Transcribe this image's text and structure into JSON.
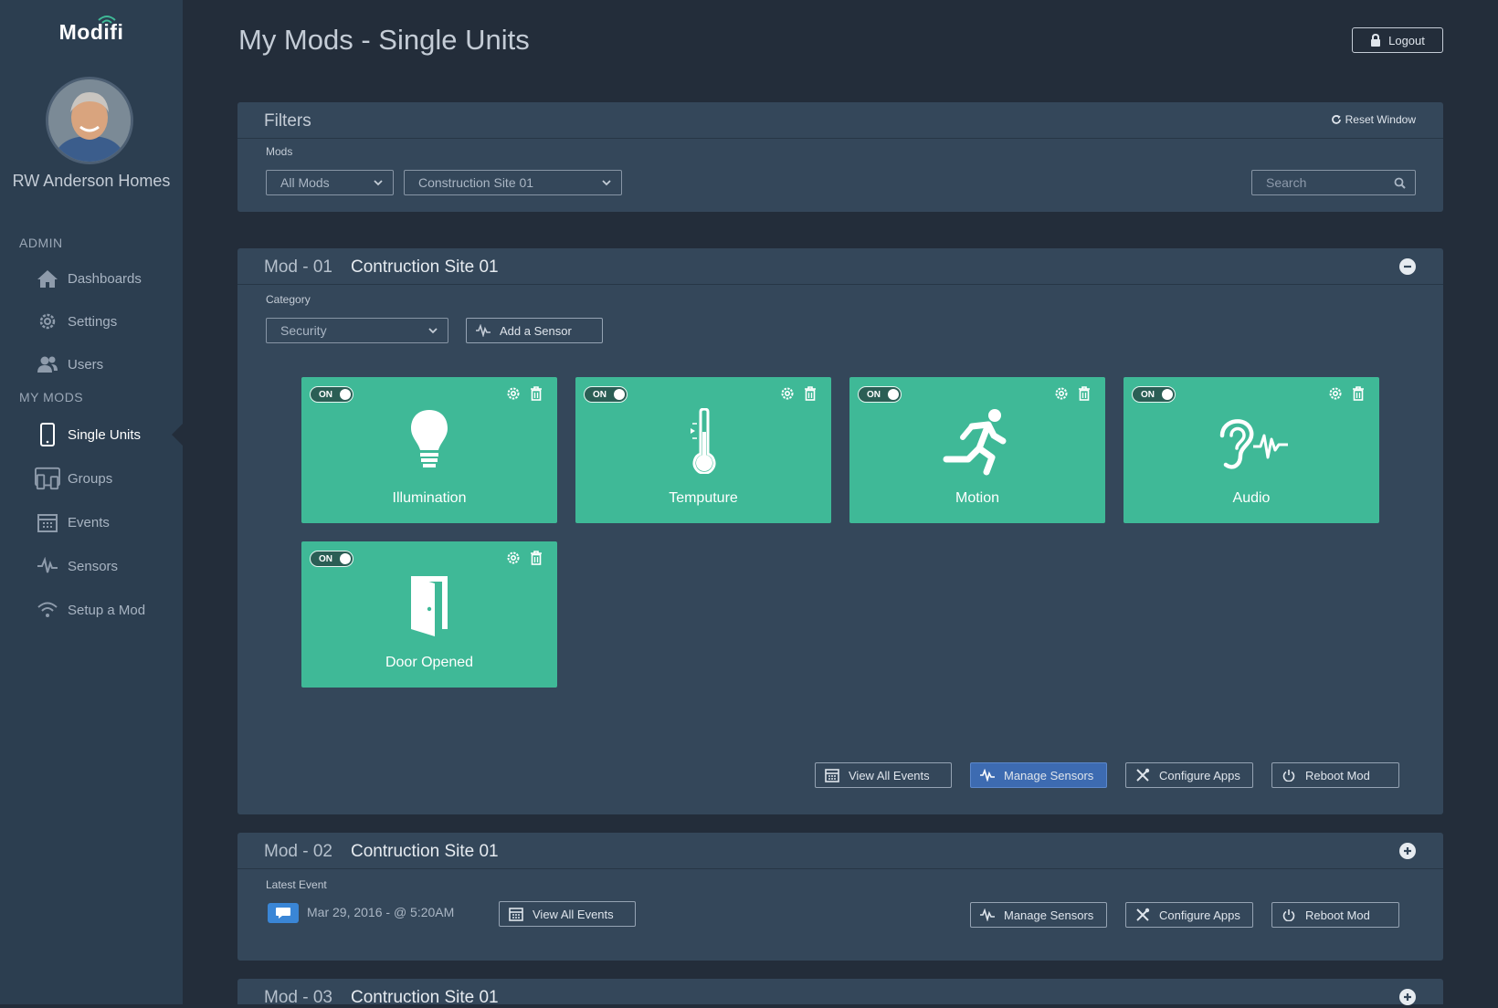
{
  "app": {
    "logo": "Modifi",
    "page_title": "My Mods - Single Units",
    "logout_label": "Logout"
  },
  "sidebar": {
    "company": "RW Anderson Homes",
    "admin_label": "ADMIN",
    "mymods_label": "MY MODS",
    "admin_items": [
      {
        "label": "Dashboards",
        "icon": "home-icon"
      },
      {
        "label": "Settings",
        "icon": "gear-icon"
      },
      {
        "label": "Users",
        "icon": "users-icon"
      }
    ],
    "mymods_items": [
      {
        "label": "Single Units",
        "icon": "phone-icon",
        "active": true
      },
      {
        "label": "Groups",
        "icon": "devices-icon"
      },
      {
        "label": "Events",
        "icon": "calendar-icon"
      },
      {
        "label": "Sensors",
        "icon": "pulse-icon"
      },
      {
        "label": "Setup a Mod",
        "icon": "wifi-icon"
      }
    ]
  },
  "filters": {
    "title": "Filters",
    "reset_label": "Reset Window",
    "mods_label": "Mods",
    "mods_select": "All Mods",
    "site_select": "Construction Site 01",
    "search_placeholder": "Search"
  },
  "mod1": {
    "number": "Mod - 01",
    "name": "Contruction Site 01",
    "category_label": "Category",
    "category_select": "Security",
    "add_sensor_label": "Add a Sensor",
    "tiles": [
      {
        "label": "Illumination",
        "state": "ON",
        "icon": "lightbulb-icon"
      },
      {
        "label": "Temputure",
        "state": "ON",
        "icon": "thermometer-icon"
      },
      {
        "label": "Motion",
        "state": "ON",
        "icon": "running-icon"
      },
      {
        "label": "Audio",
        "state": "ON",
        "icon": "ear-icon"
      },
      {
        "label": "Door Opened",
        "state": "ON",
        "icon": "door-icon"
      }
    ],
    "buttons": {
      "view_events": "View All Events",
      "manage_sensors": "Manage Sensors",
      "configure_apps": "Configure Apps",
      "reboot": "Reboot Mod"
    }
  },
  "mod2": {
    "number": "Mod - 02",
    "name": "Contruction Site 01",
    "latest_event_label": "Latest Event",
    "latest_event_text": "Mar 29, 2016  -  @ 5:20AM",
    "buttons": {
      "view_events": "View All Events",
      "manage_sensors": "Manage Sensors",
      "configure_apps": "Configure Apps",
      "reboot": "Reboot Mod"
    }
  },
  "mod3": {
    "number": "Mod - 03",
    "name": "Contruction Site 01"
  },
  "colors": {
    "sidebar": "#2c3e50",
    "background": "#232d3a",
    "panel": "#34475a",
    "tile": "#3fb997",
    "primary_button": "#3d6bb1"
  }
}
